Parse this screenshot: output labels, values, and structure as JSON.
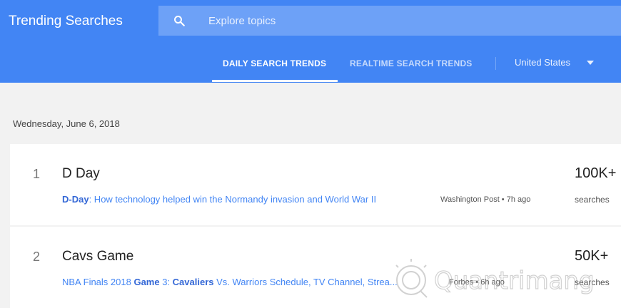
{
  "header": {
    "title": "Trending Searches",
    "search_placeholder": "Explore topics",
    "tabs": [
      {
        "label": "DAILY SEARCH TRENDS",
        "active": true
      },
      {
        "label": "REALTIME SEARCH TRENDS",
        "active": false
      }
    ],
    "country": "United States"
  },
  "main": {
    "date": "Wednesday, June 6, 2018",
    "trends": [
      {
        "rank": "1",
        "title": "D Day",
        "article_parts": [
          {
            "text": "D-Day",
            "bold": true
          },
          {
            "text": ": How technology helped win the Normandy invasion and World War II",
            "bold": false
          }
        ],
        "source": "Washington Post • 7h ago",
        "count": "100K+",
        "count_label": "searches"
      },
      {
        "rank": "2",
        "title": "Cavs Game",
        "article_parts": [
          {
            "text": "NBA Finals 2018 ",
            "bold": false
          },
          {
            "text": "Game",
            "bold": true
          },
          {
            "text": " 3: ",
            "bold": false
          },
          {
            "text": "Cavaliers",
            "bold": true
          },
          {
            "text": " Vs. Warriors Schedule, TV Channel, Strea...",
            "bold": false
          }
        ],
        "source": "Forbes • 6h ago",
        "count": "50K+",
        "count_label": "searches"
      }
    ]
  },
  "colors": {
    "header_bg": "#4285f4",
    "search_bg": "#6da1f7",
    "link": "#4285f4",
    "page_bg": "#f2f2f2"
  },
  "watermark": "Quantrimang"
}
